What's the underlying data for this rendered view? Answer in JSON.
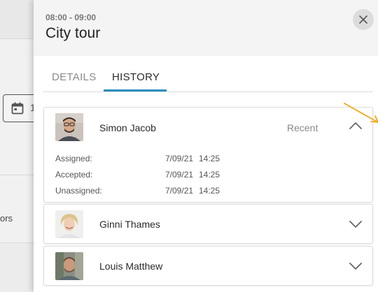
{
  "background": {
    "date_partial": "1",
    "row_partial": "ors"
  },
  "drawer": {
    "time_range": "08:00 - 09:00",
    "title": "City tour",
    "close_icon": "close-icon"
  },
  "tabs": [
    {
      "label": "DETAILS",
      "active": false
    },
    {
      "label": "HISTORY",
      "active": true
    }
  ],
  "history": [
    {
      "name": "Simon Jacob",
      "badge": "Recent",
      "expanded": true,
      "events": [
        {
          "label": "Assigned:",
          "date": "7/09/21",
          "time": "14:25"
        },
        {
          "label": "Accepted:",
          "date": "7/09/21",
          "time": "14:25"
        },
        {
          "label": "Unassigned:",
          "date": "7/09/21",
          "time": "14:25"
        }
      ]
    },
    {
      "name": "Ginni Thames",
      "expanded": false
    },
    {
      "name": "Louis Matthew",
      "expanded": false
    }
  ],
  "colors": {
    "accent": "#2a8fbd",
    "annotation_arrow": "#f0a81c"
  }
}
